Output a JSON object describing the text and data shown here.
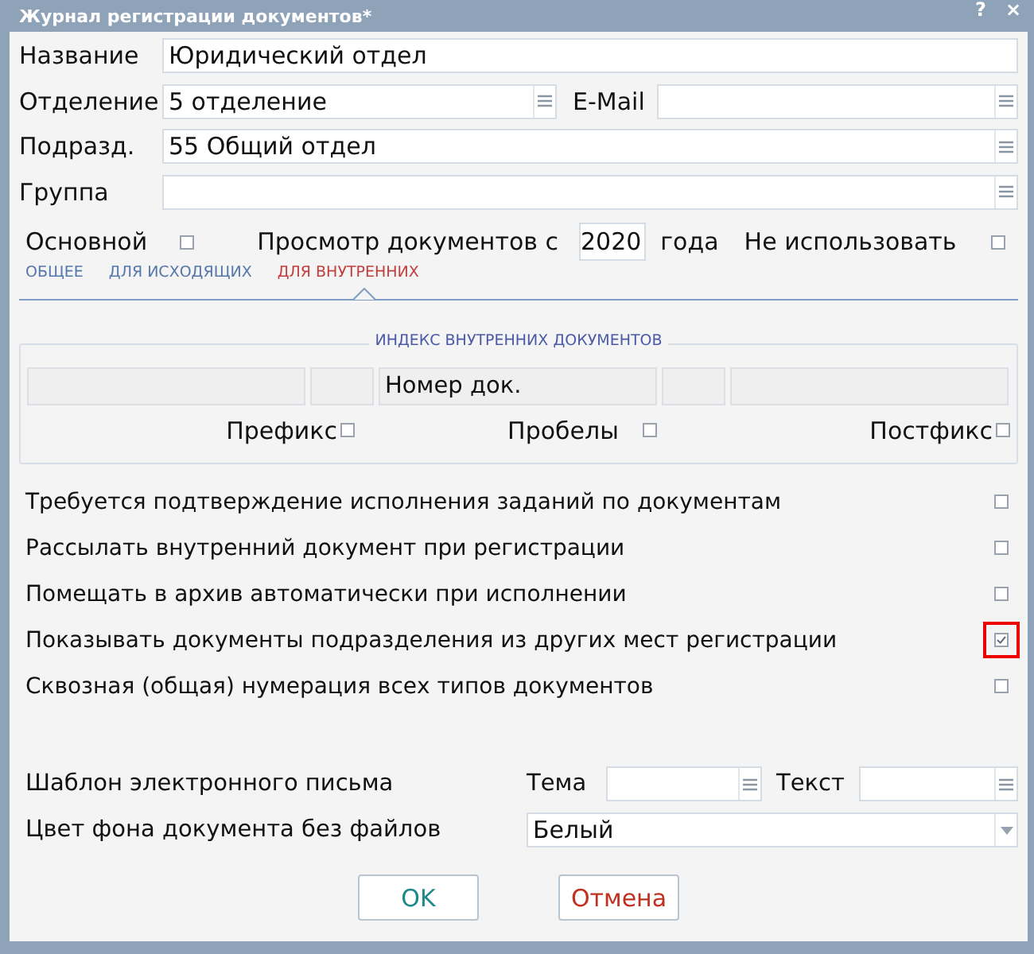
{
  "window": {
    "title": "Журнал регистрации документов*",
    "help": "?",
    "close": "×"
  },
  "fields": [
    {
      "label": "Название",
      "value": "Юридический отдел",
      "kind": "text"
    },
    {
      "label": "Отделение",
      "value": "5 отделение",
      "kind": "pair",
      "label2": "E-Mail"
    },
    {
      "label": "Подразд.",
      "value": "55 Общий отдел",
      "kind": "lookup"
    },
    {
      "label": "Группа",
      "kind": "lookup"
    }
  ],
  "flags": {
    "main_label": "Основной",
    "main_checked": false,
    "view_label": "Просмотр документов с",
    "year": "2020",
    "year_suffix": "года",
    "unused_label": "Не использовать",
    "unused_checked": false
  },
  "tabs": [
    {
      "label": "ОБЩЕЕ",
      "selected": false
    },
    {
      "label": "ДЛЯ ИСХОДЯЩИХ",
      "selected": false
    },
    {
      "label": "ДЛЯ ВНУТРЕННИХ",
      "selected": true
    }
  ],
  "index_group": {
    "title": "ИНДЕКС ВНУТРЕННИХ ДОКУМЕНТОВ",
    "number_label": "Номер док.",
    "prefix": {
      "label": "Префикс",
      "checked": false
    },
    "spaces": {
      "label": "Пробелы",
      "checked": false
    },
    "postfix": {
      "label": "Постфикс",
      "checked": false
    }
  },
  "options": [
    {
      "label": "Требуется подтверждение исполнения заданий по документам",
      "checked": false,
      "highlighted": false
    },
    {
      "label": "Рассылать внутренний документ при регистрации",
      "checked": false,
      "highlighted": false
    },
    {
      "label": "Помещать в архив автоматически при исполнении",
      "checked": false,
      "highlighted": false
    },
    {
      "label": "Показывать документы подразделения из других мест регистрации",
      "checked": true,
      "highlighted": true
    },
    {
      "label": "Сквозная (общая) нумерация всех типов документов",
      "checked": false,
      "highlighted": false
    }
  ],
  "email_template": {
    "label": "Шаблон электронного письма",
    "subject_label": "Тема",
    "text_label": "Текст"
  },
  "background_color": {
    "label": "Цвет фона документа без файлов",
    "value": "Белый"
  },
  "buttons": [
    {
      "label": "OK",
      "kind": "ok"
    },
    {
      "label": "Отмена",
      "kind": "cancel"
    }
  ]
}
